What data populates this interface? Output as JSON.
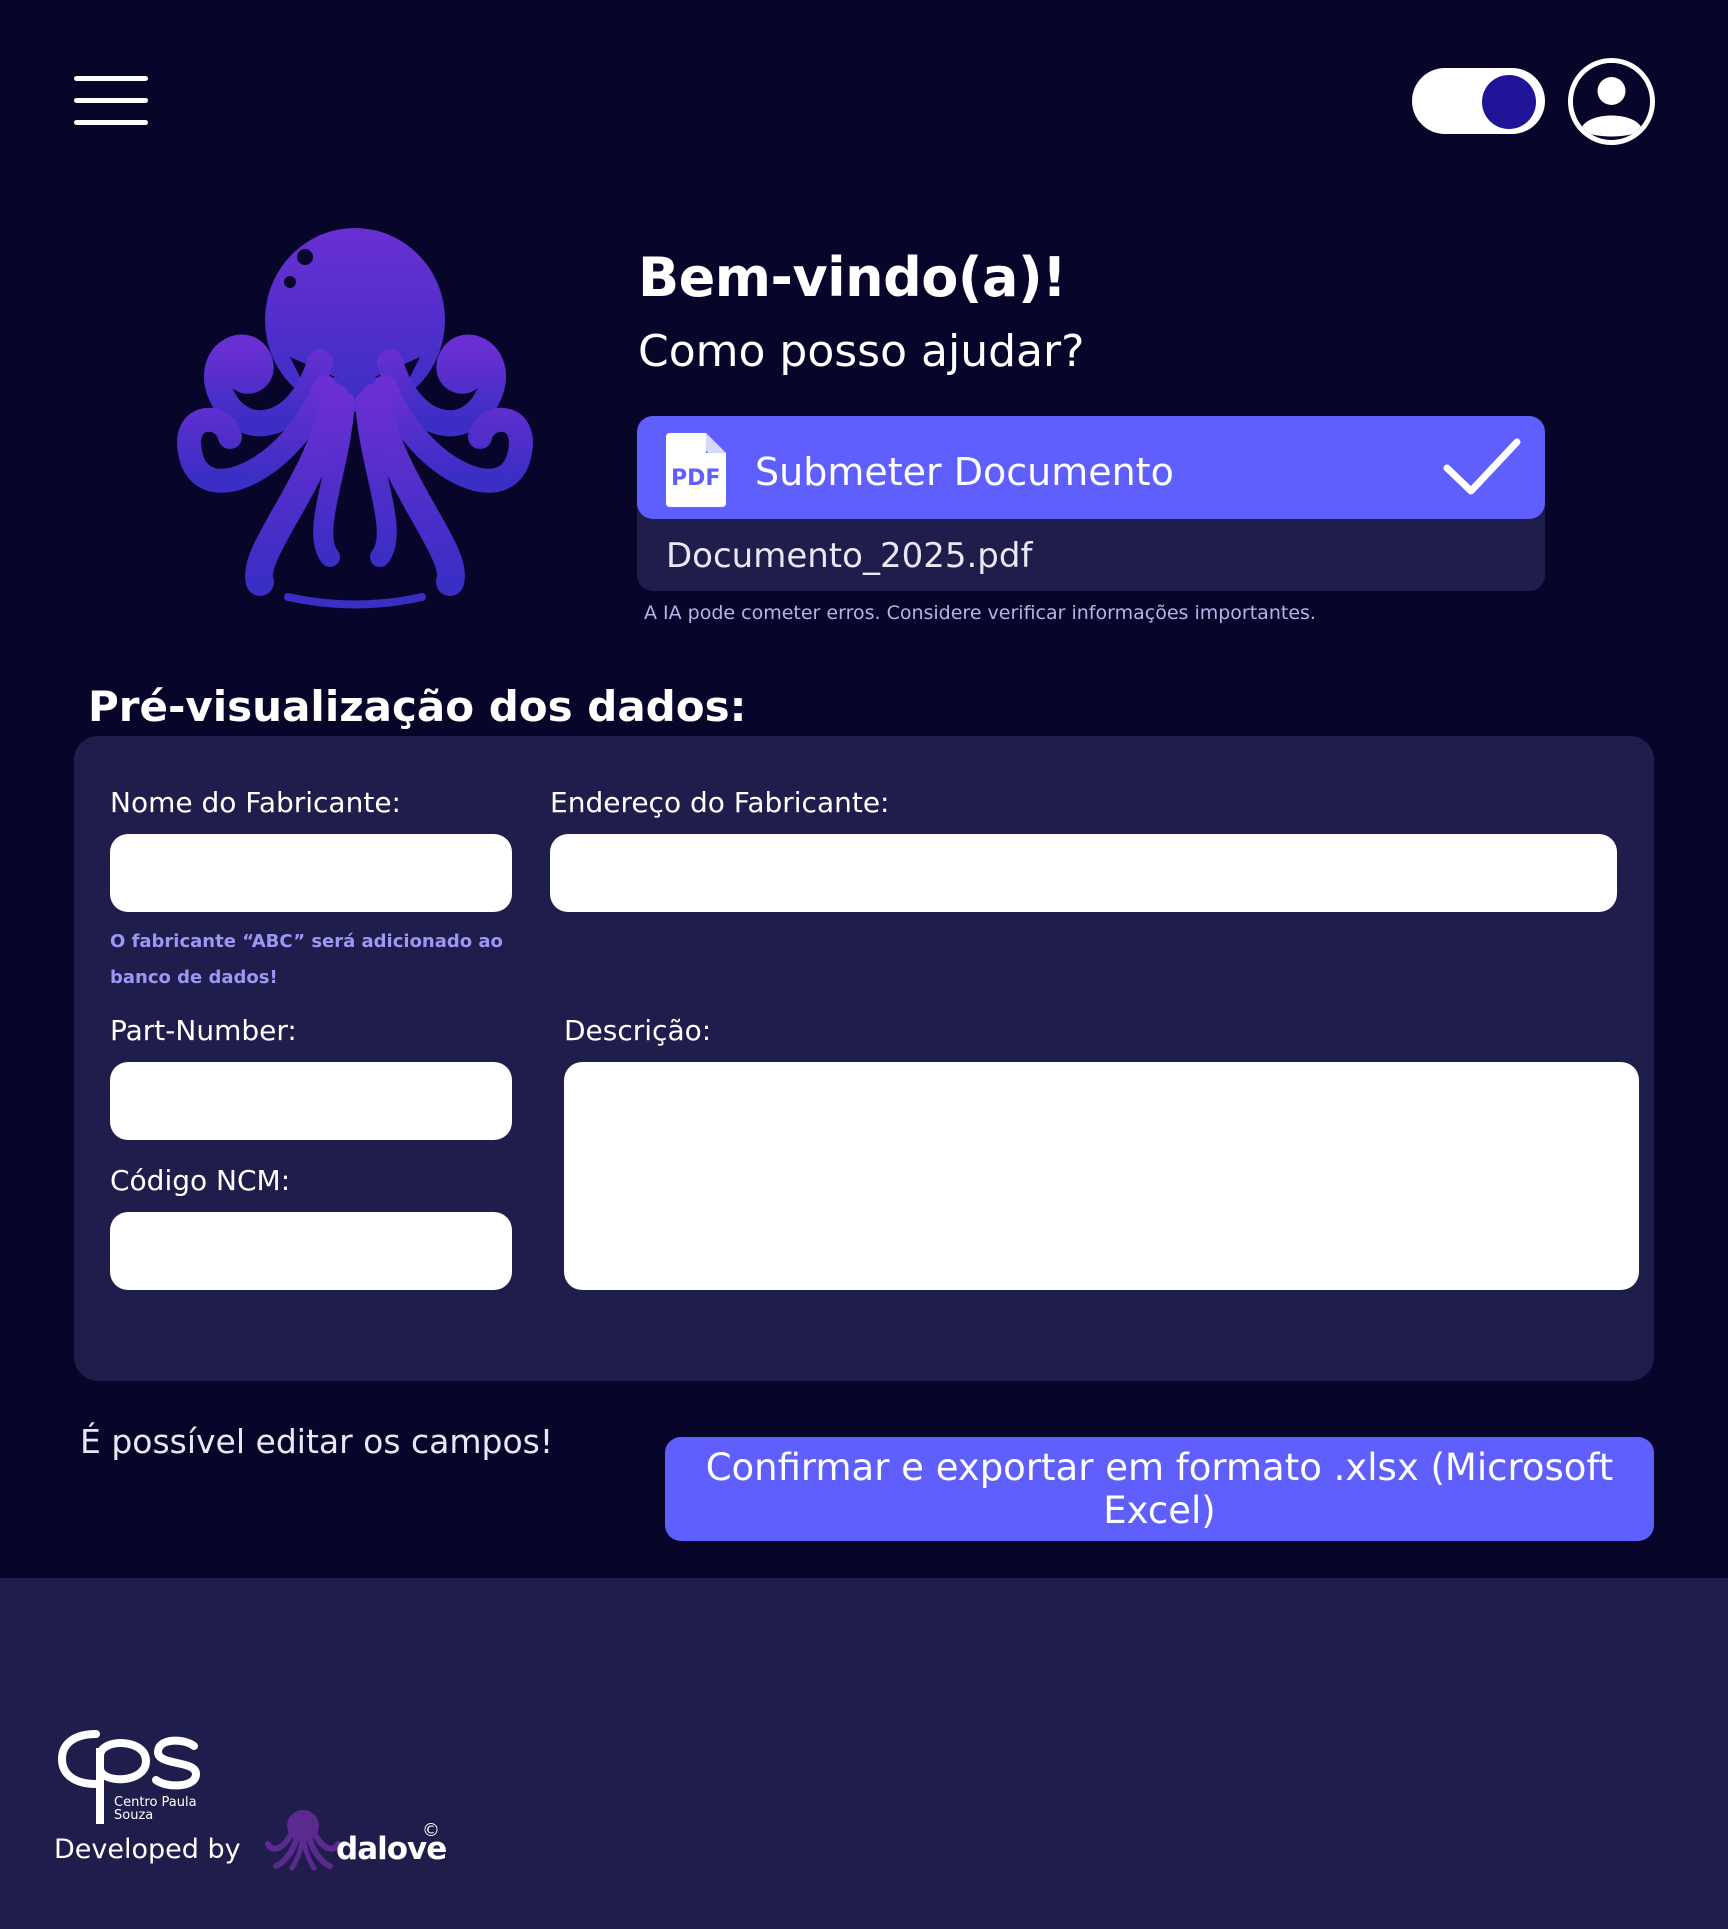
{
  "header": {
    "menu_icon": "hamburger-menu-icon",
    "theme_toggle_icon": "toggle-switch-icon",
    "user_icon": "user-avatar-icon"
  },
  "mascot": {
    "icon": "octopus-mascot-icon",
    "color": "#5a2ad0"
  },
  "welcome": {
    "title": "Bem-vindo(a)!",
    "subtitle": "Como posso ajudar?"
  },
  "upload": {
    "button_label": "Submeter Documento",
    "file_icon": "pdf-file-icon",
    "file_icon_text": "PDF",
    "status_icon": "check-icon",
    "file_name": "Documento_2025.pdf",
    "disclaimer": "A IA pode cometer erros. Considere verificar informações importantes."
  },
  "preview": {
    "title": "Pré-visualização dos dados:",
    "fields": {
      "manufacturer_name": {
        "label": "Nome do Fabricante:",
        "value": ""
      },
      "manufacturer_address": {
        "label": "Endereço do Fabricante:",
        "value": ""
      },
      "part_number": {
        "label": "Part-Number:",
        "value": ""
      },
      "ncm_code": {
        "label": "Código NCM:",
        "value": ""
      },
      "description": {
        "label": "Descrição:",
        "value": ""
      }
    },
    "manufacturer_hint": "O fabricante “ABC” será adicionado ao banco de dados!"
  },
  "actions": {
    "edit_note": "É possível editar os campos!",
    "export_button": "Confirmar e exportar em formato .xlsx (Microsoft Excel)"
  },
  "footer": {
    "cps_logo_text": "Centro Paula Souza",
    "cps_logo_abbrev": "cps",
    "developed_by": "Developed by",
    "brand": "dalove",
    "copyright_symbol": "©"
  },
  "colors": {
    "background": "#08052b",
    "panel": "#1f1d4b",
    "accent": "#5f5ffd",
    "hint": "#9d97f4"
  }
}
